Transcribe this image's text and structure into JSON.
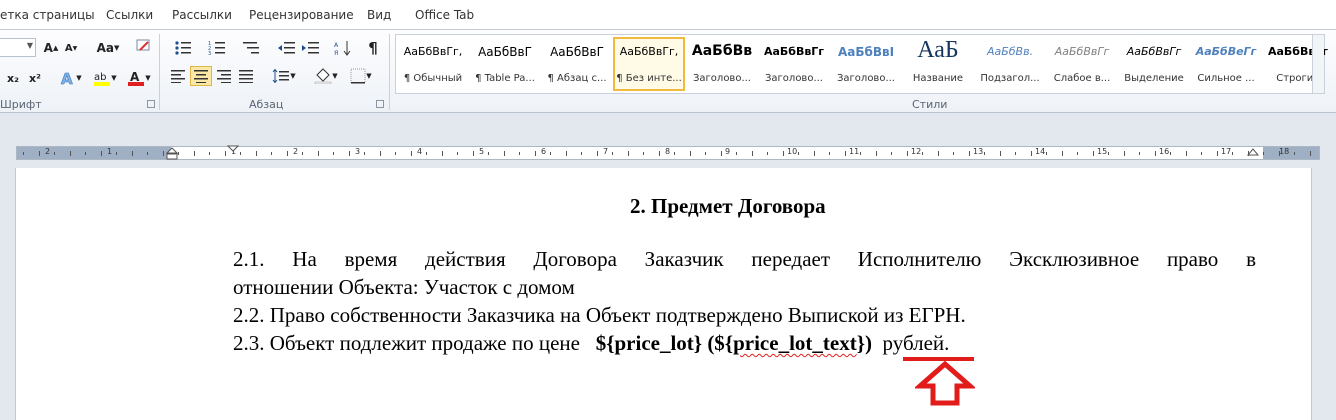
{
  "menu_tabs": [
    "етка страницы",
    "Ссылки",
    "Рассылки",
    "Рецензирование",
    "Вид",
    "Office Tab"
  ],
  "ribbon": {
    "font_group_label": "Шрифт",
    "paragraph_group_label": "Абзац",
    "styles_group_label": "Стили",
    "change_case_label": "Aa",
    "grow_font_label": "A",
    "shrink_font_label": "A"
  },
  "styles": [
    {
      "sample": "АаБбВвГг,",
      "name": "¶ Обычный"
    },
    {
      "sample": "АаБбВвГ",
      "name": "¶ Table Pa..."
    },
    {
      "sample": "АаБбВвГ",
      "name": "¶ Абзац с..."
    },
    {
      "sample": "АаБбВвГг,",
      "name": "¶ Без инте..."
    },
    {
      "sample": "АаБбВв",
      "name": "Заголово..."
    },
    {
      "sample": "АаБбВвГг",
      "name": "Заголово..."
    },
    {
      "sample": "АаБбВвІ",
      "name": "Заголово..."
    },
    {
      "sample": "АаБ",
      "name": "Название"
    },
    {
      "sample": "АаБбВв.",
      "name": "Подзагол..."
    },
    {
      "sample": "АаБбВвГг",
      "name": "Слабое в..."
    },
    {
      "sample": "АаБбВвГг",
      "name": "Выделение"
    },
    {
      "sample": "АаБбВеГг",
      "name": "Сильное ..."
    },
    {
      "sample": "АаБбВвГг",
      "name": "Строгий"
    }
  ],
  "ruler_numbers": [
    "2",
    "1",
    "1",
    "2",
    "3",
    "4",
    "5",
    "6",
    "7",
    "8",
    "9",
    "10",
    "11",
    "12",
    "13",
    "14",
    "15",
    "16",
    "17",
    "18"
  ],
  "document": {
    "heading": "2. Предмет Договора",
    "p1_line1": "2.1. На время действия Договора Заказчик передает Исполнителю Эксклюзивное право в",
    "p1_line2": "отношении Объекта: Участок с домом",
    "p2": "2.2. Право собственности Заказчика на Объект подтверждено Выпиской из ЕГРН.",
    "p3_prefix": "2.3. Объект подлежит продаже по цене",
    "p3_var1": "${price_lot}",
    "p3_open": "(${",
    "p3_var2": "price_lot_text",
    "p3_close": "})",
    "p3_suffix": "рублей."
  },
  "colors": {
    "arrow": "#e21b1b",
    "style_selected": "#f0b940",
    "squiggle": "#e02020"
  }
}
